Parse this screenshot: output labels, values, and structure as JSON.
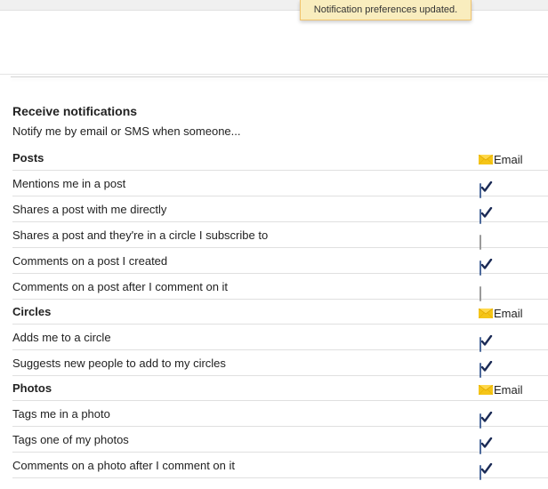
{
  "toast": {
    "message": "Notification preferences updated."
  },
  "notifications": {
    "title": "Receive notifications",
    "subtitle": "Notify me by email or SMS when someone...",
    "email_column_label": "Email",
    "email_icon": "envelope-icon",
    "groups": [
      {
        "title": "Posts",
        "items": [
          {
            "label": "Mentions me in a post",
            "email": true
          },
          {
            "label": "Shares a post with me directly",
            "email": true
          },
          {
            "label": "Shares a post and they're in a circle I subscribe to",
            "email": false
          },
          {
            "label": "Comments on a post I created",
            "email": true
          },
          {
            "label": "Comments on a post after I comment on it",
            "email": false
          }
        ]
      },
      {
        "title": "Circles",
        "items": [
          {
            "label": "Adds me to a circle",
            "email": true
          },
          {
            "label": "Suggests new people to add to my circles",
            "email": true
          }
        ]
      },
      {
        "title": "Photos",
        "items": [
          {
            "label": "Tags me in a photo",
            "email": true
          },
          {
            "label": "Tags one of my photos",
            "email": true
          },
          {
            "label": "Comments on a photo after I comment on it",
            "email": true
          }
        ]
      }
    ]
  },
  "colors": {
    "toast_bg": "#f9edbe",
    "toast_border": "#f0c36d",
    "envelope": "#f5c518",
    "checkbox_checked": "#aac4ec",
    "divider": "#e0e0e0"
  }
}
